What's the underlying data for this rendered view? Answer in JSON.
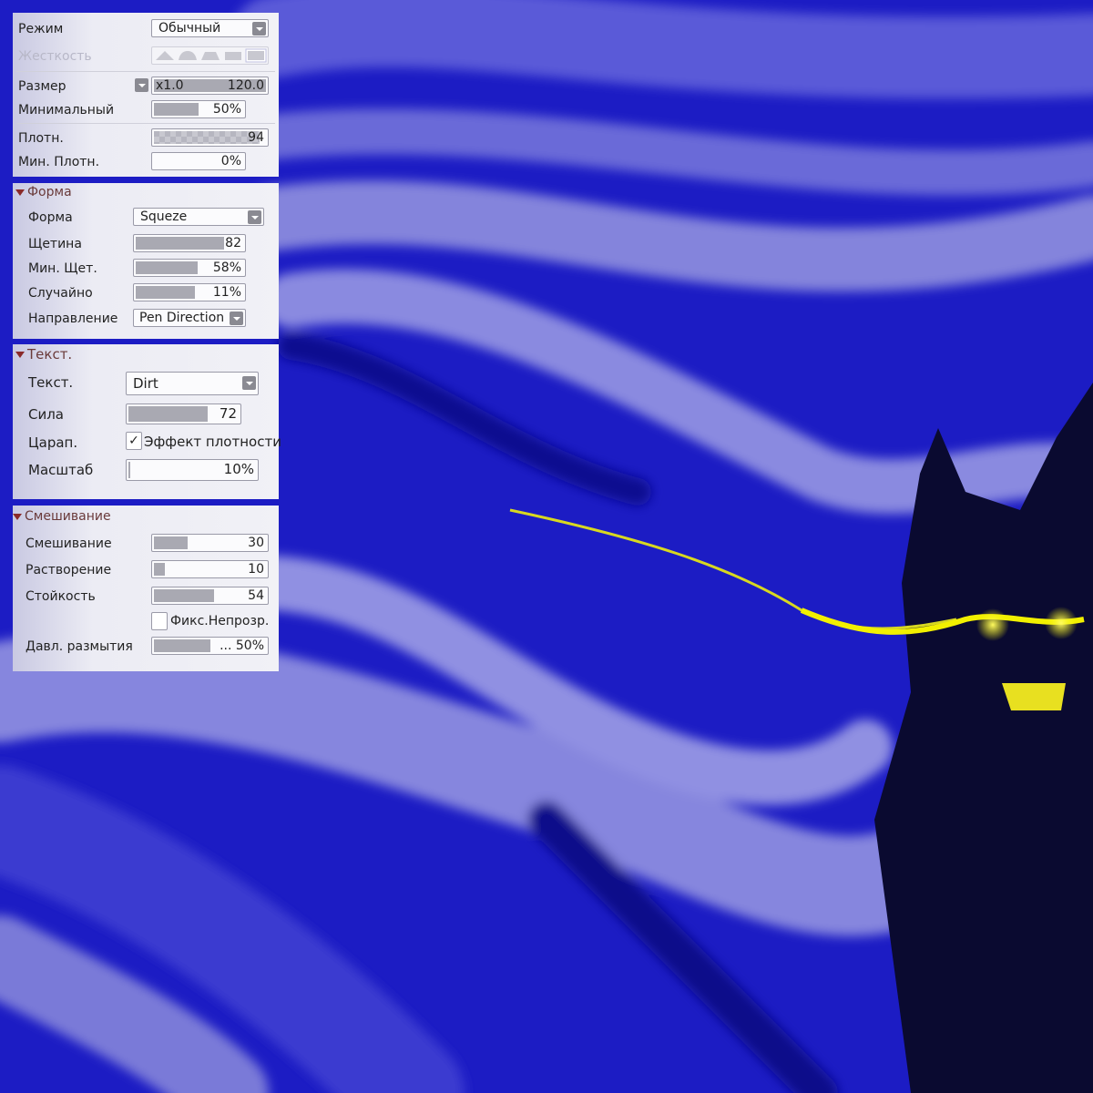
{
  "colors": {
    "canvas_base": "#1a1ac0",
    "canvas_light": "#7a7ad8",
    "eyes": "#f2f000",
    "figure": "#0a0a30"
  },
  "panel_general": {
    "mode": {
      "label": "Режим",
      "value": "Обычный"
    },
    "hardness": {
      "label": "Жесткость",
      "selected_index": 4
    },
    "size": {
      "label": "Размер",
      "multiplier": "x1.0",
      "value": "120.0"
    },
    "min_size": {
      "label": "Минимальный",
      "value": "50%",
      "fill": 0.5
    },
    "density": {
      "label": "Плотн.",
      "value": "94",
      "fill": 0.94
    },
    "min_density": {
      "label": "Мин. Плотн.",
      "value": "0%",
      "fill": 0
    }
  },
  "panel_shape": {
    "title": "Форма",
    "shape": {
      "label": "Форма",
      "value": "Squeze"
    },
    "bristle": {
      "label": "Щетина",
      "value": "82",
      "fill": 0.82
    },
    "min_bristle": {
      "label": "Мин. Щет.",
      "value": "58%",
      "fill": 0.58
    },
    "random": {
      "label": "Случайно",
      "value": "11%",
      "fill": 0.55
    },
    "direction": {
      "label": "Направление",
      "value": "Pen Direction"
    }
  },
  "panel_texture": {
    "title": "Текст.",
    "texture": {
      "label": "Текст.",
      "value": "Dirt"
    },
    "strength": {
      "label": "Сила",
      "value": "72",
      "fill": 0.72
    },
    "scratch": {
      "label": "Царап.",
      "checkbox_label": "Эффект плотности",
      "checked": true,
      "check_mark": "✓"
    },
    "scale": {
      "label": "Масштаб",
      "value": "10%",
      "fill": 0.01
    }
  },
  "panel_blend": {
    "title": "Смешивание",
    "blending": {
      "label": "Смешивание",
      "value": "30",
      "fill": 0.3
    },
    "dilution": {
      "label": "Растворение",
      "value": "10",
      "fill": 0.1
    },
    "persistence": {
      "label": "Стойкость",
      "value": "54",
      "fill": 0.54
    },
    "fix_opacity": {
      "checkbox_label": "Фикс.Непрозр.",
      "checked": false
    },
    "blur_pressure": {
      "label": "Давл. размытия",
      "value": "... 50%",
      "fill": 0.5
    }
  }
}
